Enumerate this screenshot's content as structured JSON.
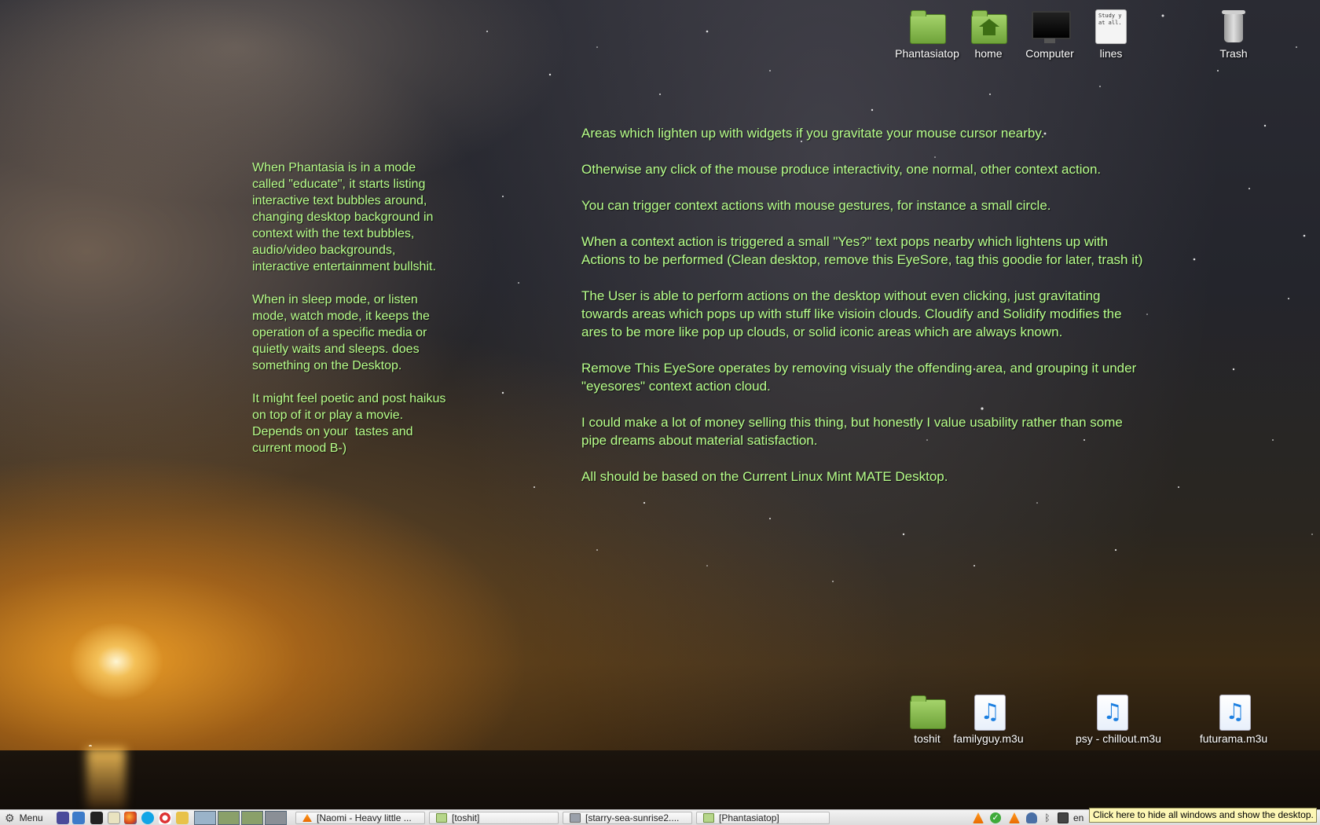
{
  "desktop": {
    "top_icons": [
      {
        "label": "Phantasiatop",
        "icon": "folder-icon"
      },
      {
        "label": "home",
        "icon": "home-folder-icon"
      },
      {
        "label": "Computer",
        "icon": "computer-icon"
      },
      {
        "label": "lines",
        "icon": "text-document-icon",
        "preview": "Study y\nat all."
      },
      {
        "label": "Trash",
        "icon": "trash-icon"
      }
    ],
    "bottom_icons": [
      {
        "label": "toshit",
        "icon": "folder-icon"
      },
      {
        "label": "familyguy.m3u",
        "icon": "music-playlist-icon"
      },
      {
        "label": "psy - chillout.m3u",
        "icon": "music-playlist-icon"
      },
      {
        "label": "futurama.m3u",
        "icon": "music-playlist-icon"
      }
    ]
  },
  "left_text": {
    "paragraphs": [
      "When Phantasia is in a mode\ncalled \"educate\", it starts listing\ninteractive text bubbles around,\nchanging desktop background in\ncontext with the text bubbles,\naudio/video backgrounds,\ninteractive entertainment bullshit.",
      "When in sleep mode, or listen\nmode, watch mode, it keeps the\noperation of a specific media or\nquietly waits and sleeps. does\nsomething on the Desktop.",
      "It might feel poetic and post haikus\non top of it or play a movie.\nDepends on your  tastes and\ncurrent mood B-)"
    ]
  },
  "right_text": {
    "paragraphs": [
      "Areas which lighten up with widgets if you gravitate your mouse cursor nearby.",
      "Otherwise any click of the mouse produce interactivity, one normal, other context action.",
      "You can trigger context actions with mouse gestures, for instance a small circle.",
      "When a context action is triggered a small \"Yes?\" text pops nearby which lightens up with\nActions to be performed (Clean desktop, remove this EyeSore, tag this goodie for later, trash it)",
      "The User is able to perform actions on the desktop without even clicking, just gravitating\ntowards areas which pops up with stuff like visioin clouds. Cloudify and Solidify modifies the\nares to be more like pop up clouds, or solid iconic areas which are always known.",
      "Remove This EyeSore operates by removing visualy the offending area, and grouping it under\n\"eyesores\" context action cloud.",
      "I could make a lot of money selling this thing, but honestly I value usability rather than some\npipe dreams about material satisfaction.",
      "All should be based on the Current Linux Mint MATE Desktop."
    ]
  },
  "taskbar": {
    "menu_label": "Menu",
    "launchers": [
      "network-icon",
      "browser-icon",
      "terminal-icon",
      "notes-icon",
      "firefox-icon",
      "skype-icon",
      "lifebuoy-icon",
      "folder-icon"
    ],
    "windows": [
      {
        "label": "[Naomi - Heavy little ...",
        "icon": "vlc-icon"
      },
      {
        "label": "[toshit]",
        "icon": "folder-icon"
      },
      {
        "label": "[starry-sea-sunrise2....",
        "icon": "image-icon"
      },
      {
        "label": "[Phantasiatop]",
        "icon": "folder-icon"
      }
    ],
    "tray": [
      "vlc-icon",
      "check-icon",
      "vlc-icon",
      "shield-icon",
      "bluetooth-icon",
      "display-icon"
    ],
    "keyboard_layout": "en",
    "show_desktop_tooltip": "Click here to hide all windows and show the desktop."
  },
  "colors": {
    "desktop_text": "#b7ff8a",
    "folder_green": "#8fbf55",
    "tooltip_bg": "#fdf7b5"
  }
}
